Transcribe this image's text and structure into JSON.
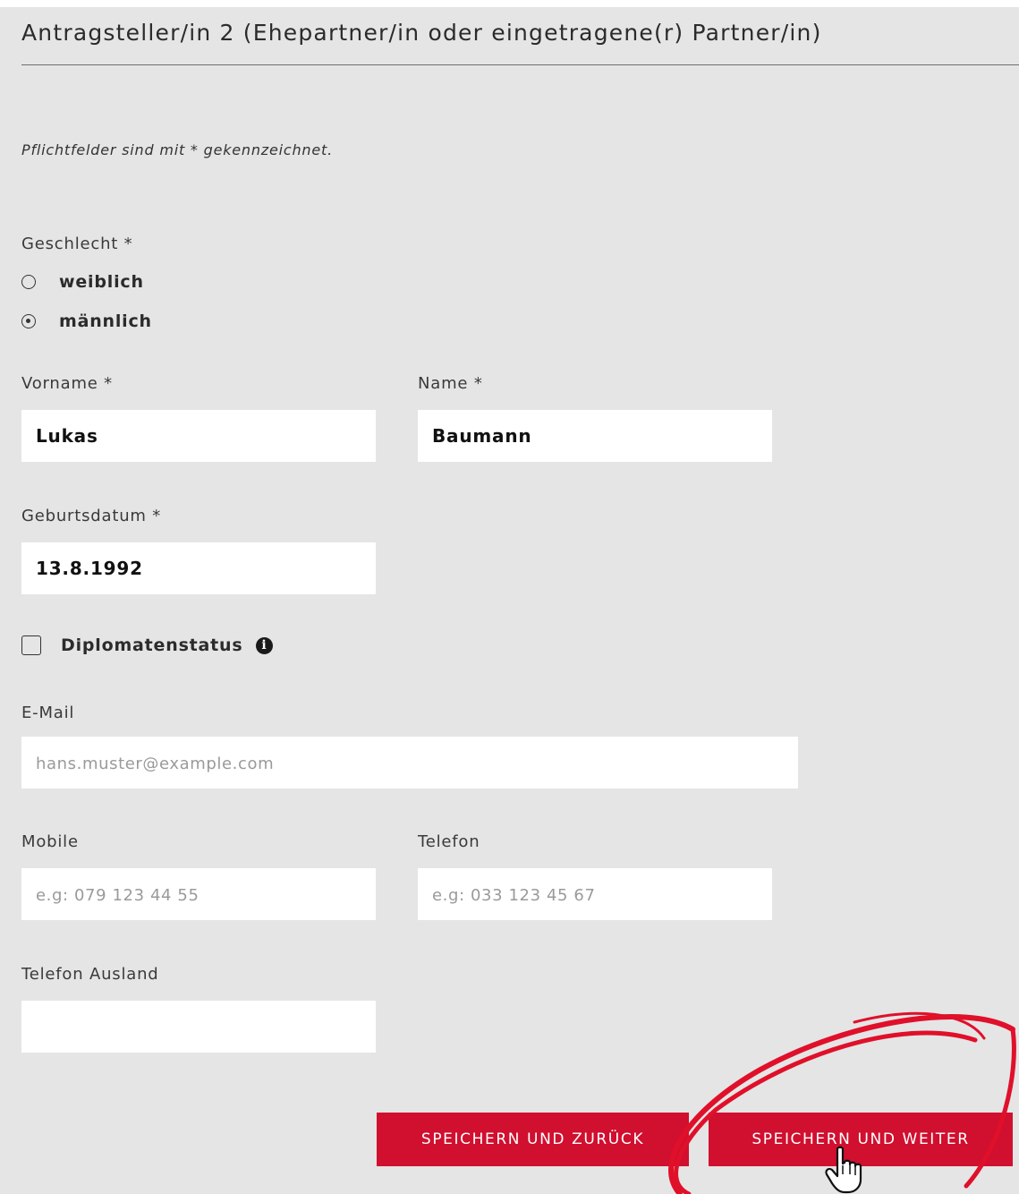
{
  "section": {
    "title": "Antragsteller/in 2 (Ehepartner/in oder eingetragene(r) Partner/in)",
    "required_hint": "Pflichtfelder sind mit * gekennzeichnet."
  },
  "gender": {
    "label": "Geschlecht *",
    "options": [
      {
        "label": "weiblich",
        "checked": false
      },
      {
        "label": "männlich",
        "checked": true
      }
    ]
  },
  "firstname": {
    "label": "Vorname *",
    "value": "Lukas"
  },
  "lastname": {
    "label": "Name *",
    "value": "Baumann"
  },
  "birthdate": {
    "label": "Geburtsdatum *",
    "value": "13.8.1992"
  },
  "diplomat": {
    "label": "Diplomatenstatus",
    "checked": false
  },
  "email": {
    "label": "E-Mail",
    "value": "",
    "placeholder": "hans.muster@example.com"
  },
  "mobile": {
    "label": "Mobile",
    "value": "",
    "placeholder": "e.g: 079 123 44 55"
  },
  "phone": {
    "label": "Telefon",
    "value": "",
    "placeholder": "e.g: 033 123 45 67"
  },
  "phone_abroad": {
    "label": "Telefon Ausland",
    "value": "",
    "placeholder": ""
  },
  "buttons": {
    "save_back": "SPEICHERN UND ZURÜCK",
    "save_next": "SPEICHERN UND WEITER"
  },
  "colors": {
    "button_red": "#d10f2f",
    "annotation_red": "#e0102a",
    "panel_bg": "#e5e5e5"
  },
  "icons": {
    "info": "info-icon",
    "cursor": "hand-pointer-cursor-icon"
  }
}
